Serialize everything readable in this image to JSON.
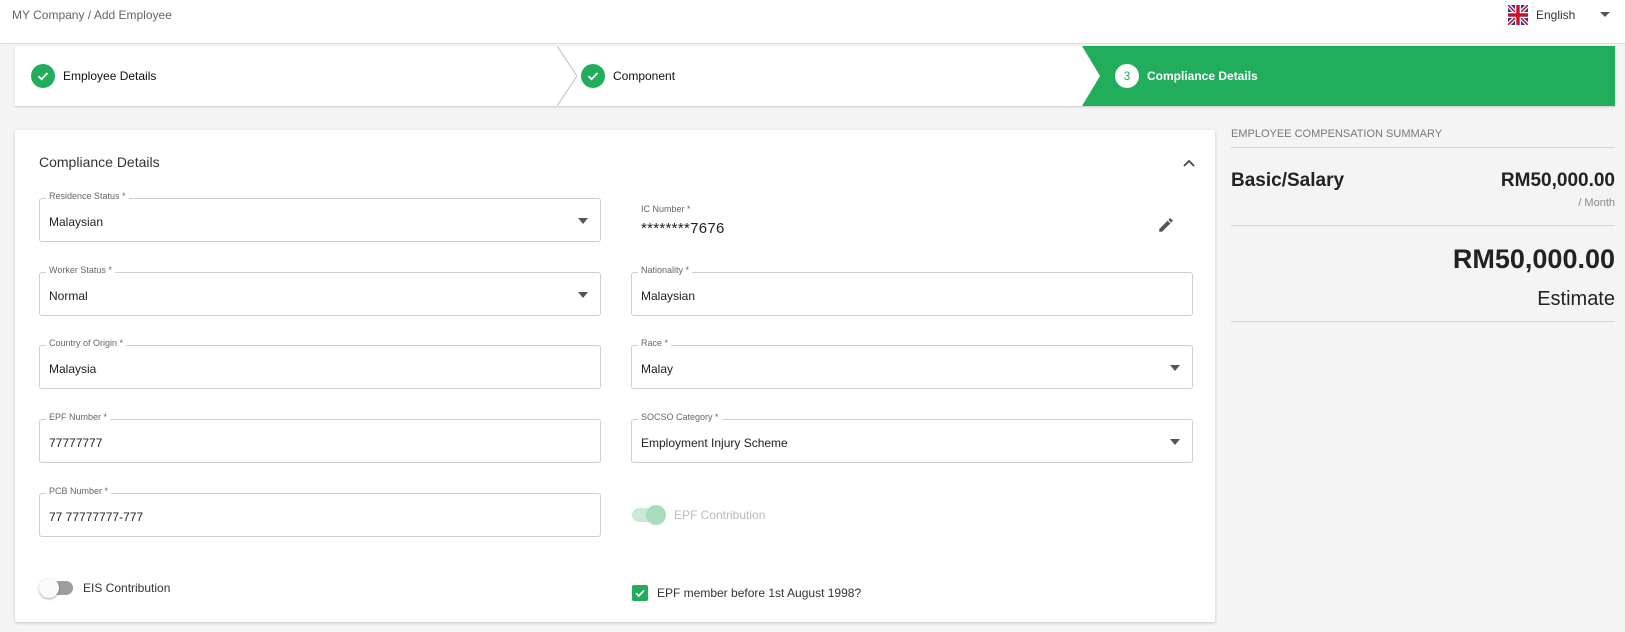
{
  "breadcrumb": "MY Company / Add Employee",
  "language": {
    "label": "English",
    "flag_icon": "uk-flag-icon"
  },
  "colors": {
    "accent": "#21ad5b",
    "toggle_off": "#9e9e9e"
  },
  "steps": [
    {
      "label": "Employee Details",
      "state": "done",
      "icon": "check-icon"
    },
    {
      "label": "Component",
      "state": "done",
      "icon": "check-icon"
    },
    {
      "label": "Compliance Details",
      "state": "active",
      "number": "3"
    }
  ],
  "form": {
    "title": "Compliance Details",
    "residence_status": {
      "label": "Residence Status *",
      "value": "Malaysian"
    },
    "ic_number": {
      "label": "IC Number *",
      "value": "********7676"
    },
    "worker_status": {
      "label": "Worker Status *",
      "value": "Normal"
    },
    "nationality": {
      "label": "Nationality *",
      "value": "Malaysian"
    },
    "country_of_origin": {
      "label": "Country of Origin *",
      "value": "Malaysia"
    },
    "race": {
      "label": "Race *",
      "value": "Malay"
    },
    "epf_number": {
      "label": "EPF Number *",
      "value": "77777777"
    },
    "socso_category": {
      "label": "SOCSO Category *",
      "value": "Employment Injury Scheme"
    },
    "pcb_number": {
      "label": "PCB Number *",
      "value": "77 77777777-777"
    },
    "epf_contribution": {
      "label": "EPF Contribution",
      "on": true,
      "disabled": true
    },
    "eis_contribution": {
      "label": "EIS Contribution",
      "on": false
    },
    "epf_member_before_1998": {
      "label": "EPF member before 1st August 1998?",
      "checked": true
    }
  },
  "summary": {
    "heading": "EMPLOYEE COMPENSATION SUMMARY",
    "rows": [
      {
        "name": "Basic/Salary",
        "amount": "RM50,000.00",
        "period": "/ Month"
      }
    ],
    "total": "RM50,000.00",
    "total_label": "Estimate"
  }
}
